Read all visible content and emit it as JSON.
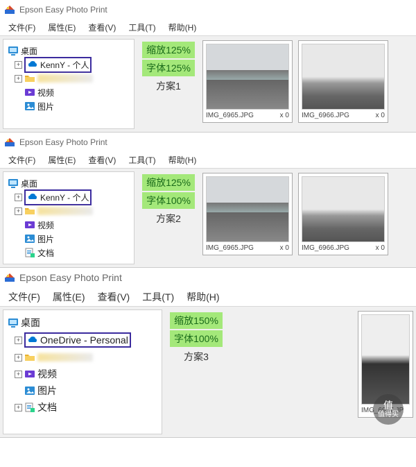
{
  "app": {
    "title": "Epson Easy Photo Print"
  },
  "menu": {
    "file": "文件(F)",
    "props": "属性(E)",
    "view": "查看(V)",
    "tools": "工具(T)",
    "help": "帮助(H)"
  },
  "tree": {
    "desktop": "桌面",
    "kenny": "KennY - 个人",
    "onedrive": "OneDrive - Personal",
    "video": "视频",
    "pictures": "图片",
    "docs": "文档"
  },
  "panels": [
    {
      "zoom": "缩放125%",
      "font": "字体125%",
      "scheme": "方案1",
      "thumbs": [
        {
          "name": "IMG_6965.JPG",
          "count": "x 0"
        },
        {
          "name": "IMG_6966.JPG",
          "count": "x 0"
        }
      ]
    },
    {
      "zoom": "缩放125%",
      "font": "字体100%",
      "scheme": "方案2",
      "thumbs": [
        {
          "name": "IMG_6965.JPG",
          "count": "x 0"
        },
        {
          "name": "IMG_6966.JPG",
          "count": "x 0"
        }
      ]
    },
    {
      "zoom": "缩放150%",
      "font": "字体100%",
      "scheme": "方案3",
      "thumbs": [
        {
          "name": "IMG_6967.JP",
          "count": ""
        }
      ]
    }
  ],
  "watermark": {
    "sym": "值",
    "text": "值得买"
  }
}
